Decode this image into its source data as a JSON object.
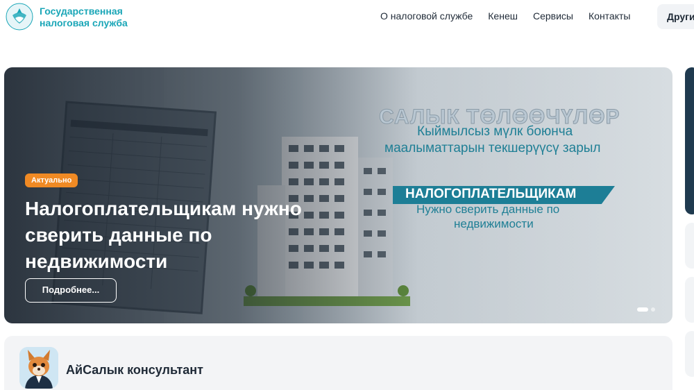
{
  "header": {
    "brand_line1": "Государственная",
    "brand_line2": "налоговая служба",
    "nav": [
      "О налоговой службе",
      "Кенеш",
      "Сервисы",
      "Контакты"
    ],
    "other_label": "Други"
  },
  "hero": {
    "badge": "Актуально",
    "title": "Налогоплательщикам нужно сверить данные по недвижимости",
    "more_label": "Подробнее...",
    "banner": {
      "line1": "САЛЫК ТӨЛӨӨЧҮЛӨР",
      "line2": "Кыймылсыз мүлк боюнча",
      "line3": "маалыматтарын текшерүүсү зарыл",
      "line4": "НАЛОГОПЛАТЕЛЬЩИКАМ",
      "line5": "Нужно сверить данные по",
      "line6": "недвижимости"
    },
    "slides_total": 2,
    "slide_active": 1
  },
  "consultant": {
    "title": "АйСалык консультант"
  },
  "colors": {
    "brand": "#1aa6b7",
    "badge": "#f08a24",
    "banner_teal": "#1d7e96"
  }
}
